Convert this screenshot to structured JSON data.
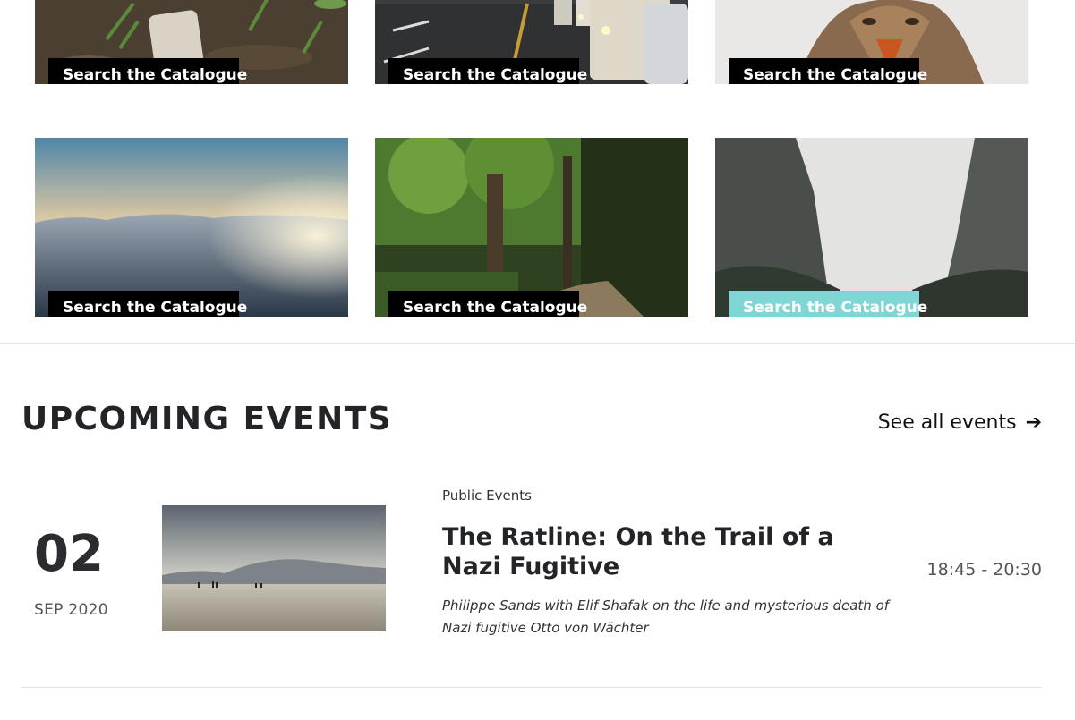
{
  "catalogue": {
    "cards": [
      {
        "button_label": "Search the Catalogue",
        "image": "leaves-on-ground-photo"
      },
      {
        "button_label": "Search the Catalogue",
        "image": "road-traffic-photo"
      },
      {
        "button_label": "Search the Catalogue",
        "image": "coyote-photo"
      },
      {
        "button_label": "Search the Catalogue",
        "image": "clouds-sunset-photo"
      },
      {
        "button_label": "Search the Catalogue",
        "image": "forest-path-photo"
      },
      {
        "button_label": "Search the Catalogue",
        "image": "misty-canyon-photo"
      }
    ],
    "button_color": "#000000",
    "button_hover_color": "#7fd6d4"
  },
  "events": {
    "heading": "UPCOMING EVENTS",
    "see_all_label": "See all events",
    "see_all_icon": "arrow-right-icon",
    "items": [
      {
        "day": "02",
        "month_year": "SEP 2020",
        "category": "Public Events",
        "title": "The Ratline: On the Trail of a Nazi Fugitive",
        "description": "Philippe Sands with Elif Shafak on the life and mysterious death of Nazi fugitive Otto von Wächter",
        "time": "18:45 - 20:30",
        "image": "beach-mountains-photo"
      }
    ]
  }
}
